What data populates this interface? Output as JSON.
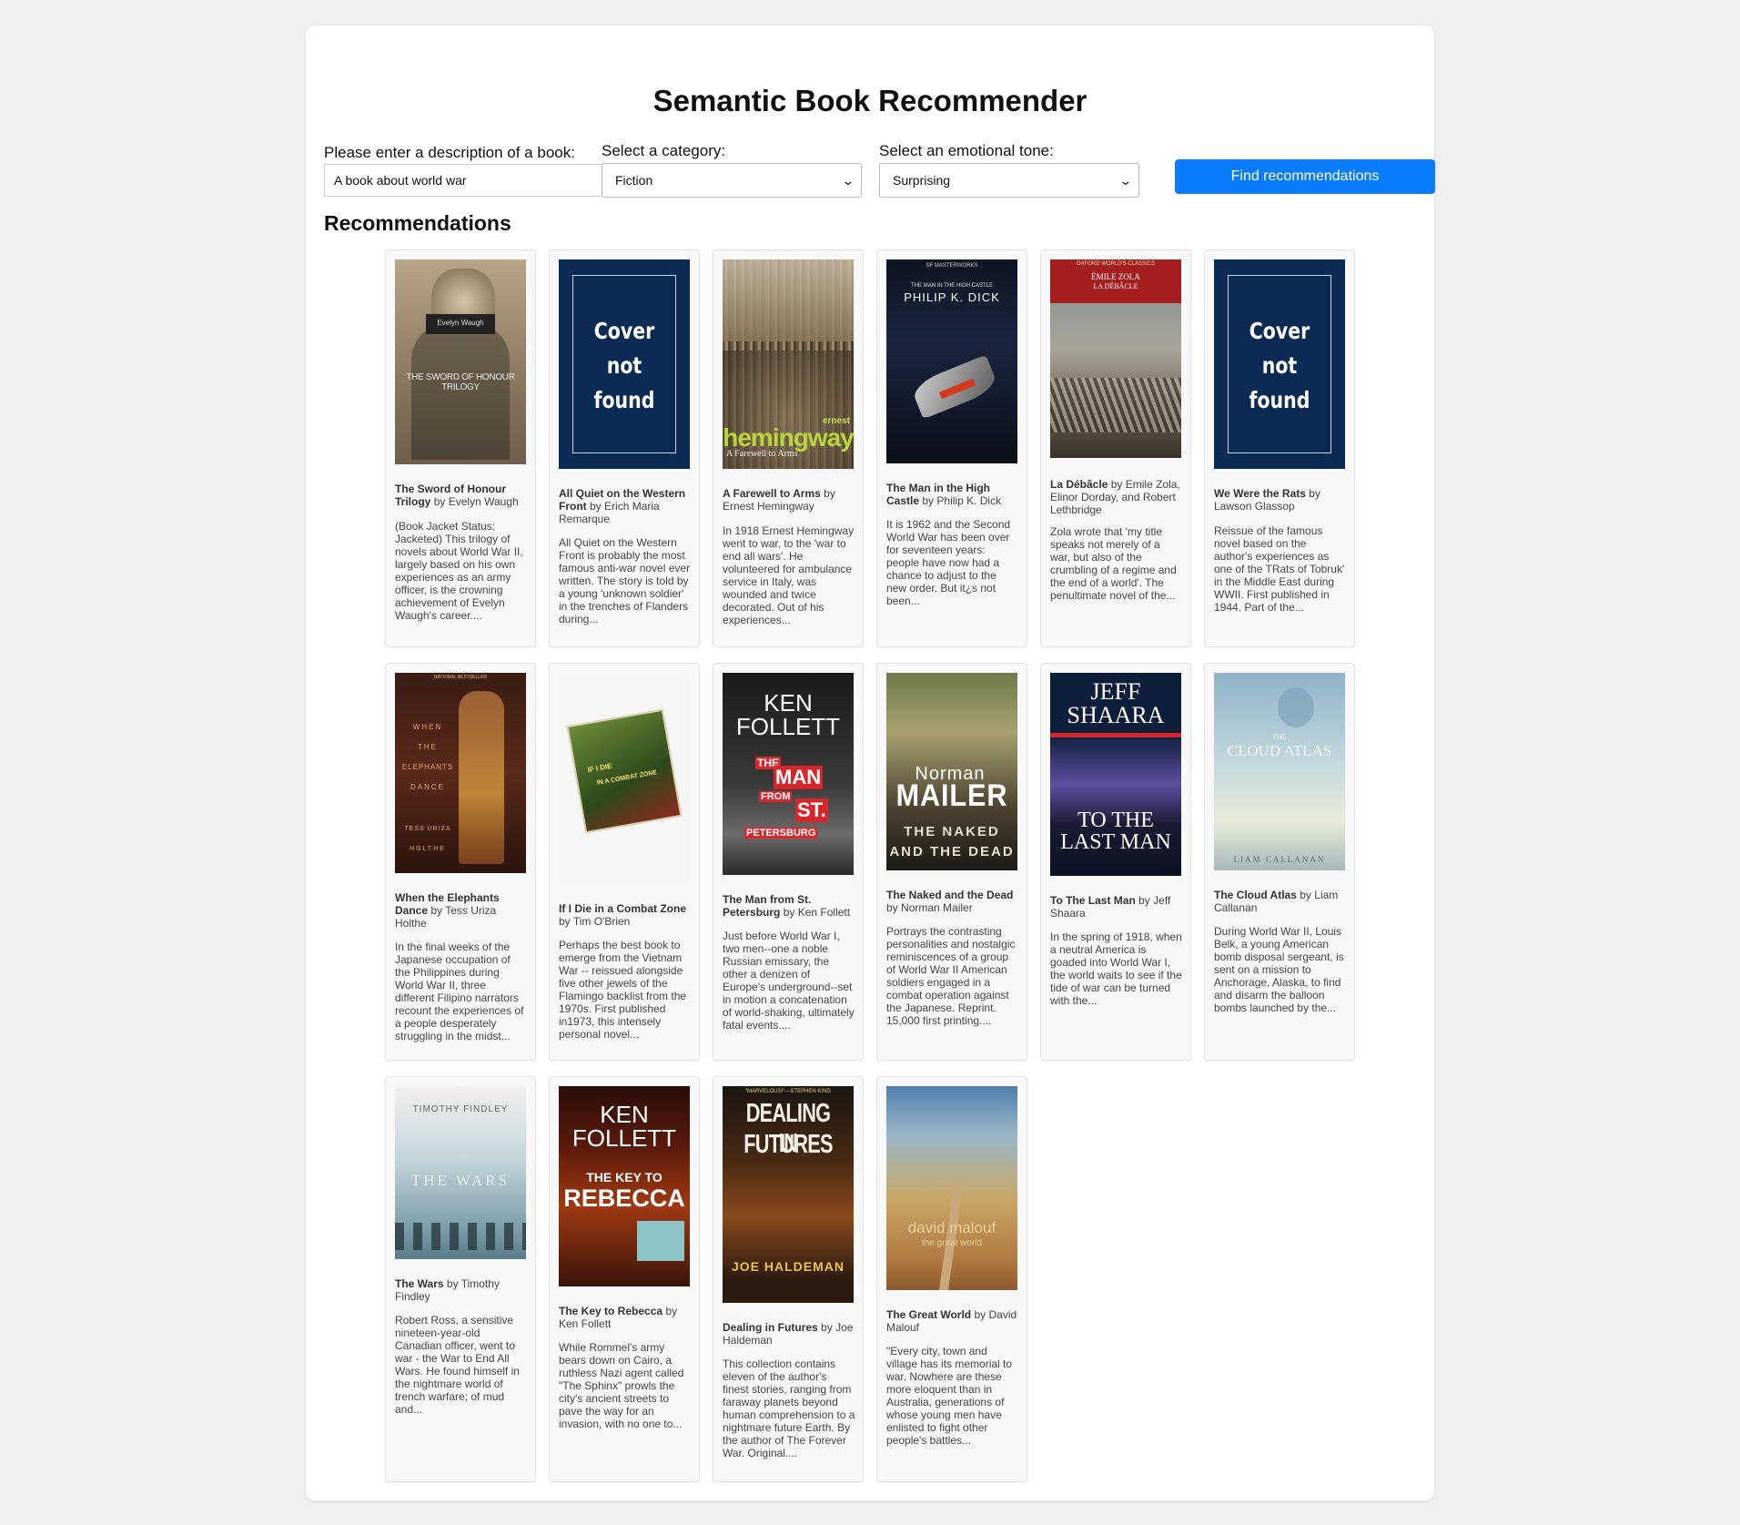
{
  "app": {
    "title": "Semantic Book Recommender"
  },
  "form": {
    "description_label": "Please enter a description of a book:",
    "description_value": "A book about world war",
    "category_label": "Select a category:",
    "category_value": "Fiction",
    "tone_label": "Select an emotional tone:",
    "tone_value": "Surprising",
    "submit_label": "Find recommendations"
  },
  "recommendations_heading": "Recommendations",
  "books": [
    {
      "title": "The Sword of Honour Trilogy",
      "by": "by",
      "author": "Evelyn Waugh",
      "cover": "photo-soldier",
      "cover_text": [
        "Evelyn Waugh",
        "THE SWORD OF HONOUR TRILOGY"
      ],
      "description": "(Book Jacket Status: Jacketed) This trilogy of novels about World War II, largely based on his own experiences as an army officer, is the crowning achievement of Evelyn Waugh's career...."
    },
    {
      "title": "All Quiet on the Western Front",
      "by": "by",
      "author": "Erich Maria Remarque",
      "cover": "not-found",
      "cover_text": [
        "Cover",
        "not",
        "found"
      ],
      "description": "All Quiet on the Western Front is probably the most famous anti-war novel ever written. The story is told by a young 'unknown soldier' in the trenches of Flanders during..."
    },
    {
      "title": "A Farewell to Arms",
      "by": "by",
      "author": "Ernest Hemingway",
      "cover": "city-crowd",
      "cover_text": [
        "ernest",
        "hemingway",
        "A Farewell to Arms"
      ],
      "description": "In 1918 Ernest Hemingway went to war, to the 'war to end all wars'. He volunteered for ambulance service in Italy, was wounded and twice decorated. Out of his experiences..."
    },
    {
      "title": "The Man in the High Castle",
      "by": "by",
      "author": "Philip K. Dick",
      "cover": "space",
      "cover_text": [
        "SF MASTERWORKS",
        "THE MAN IN THE HIGH CASTLE",
        "PHILIP K. DICK"
      ],
      "description": "It is 1962 and the Second World War has been over for seventeen years: people have now had a chance to adjust to the new order. But it¿s not been..."
    },
    {
      "title": "La Débâcle",
      "by": "by",
      "author": "Emile Zola, Elinor Dorday, and Robert Lethbridge",
      "cover": "battle-painting",
      "cover_text": [
        "OXFORD WORLD'S CLASSICS",
        "ÉMILE ZOLA",
        "LA DÉBÂCLE"
      ],
      "description": "Zola wrote that 'my title speaks not merely of a war, but also of the crumbling of a regime and the end of a world'. The penultimate novel of the..."
    },
    {
      "title": "We Were the Rats",
      "by": "by",
      "author": "Lawson Glassop",
      "cover": "not-found",
      "cover_text": [
        "Cover",
        "not",
        "found"
      ],
      "description": "Reissue of the famous novel based on the author's experiences as one of the TRats of Tobruk' in the Middle East during WWII. First published in 1944. Part of the..."
    },
    {
      "title": "When the Elephants Dance",
      "by": "by",
      "author": "Tess Uriza Holthe",
      "cover": "elephants",
      "cover_text": [
        "NATIONAL BESTSELLER",
        "WHEN",
        "THE",
        "ELEPHANTS",
        "DANCE",
        "TESS URIZA",
        "HOLTHE"
      ],
      "description": "In the final weeks of the Japanese occupation of the Philippines during World War II, three different Filipino narrators recount the experiences of a people desperately struggling in the midst..."
    },
    {
      "title": "If I Die in a Combat Zone",
      "by": "by",
      "author": "Tim O'Brien",
      "cover": "combat-zone",
      "cover_text": [
        "IF I DIE",
        "IN A COMBAT ZONE"
      ],
      "description": "Perhaps the best book to emerge from the Vietnam War -- reissued alongside five other jewels of the Flamingo backlist from the 1970s. First published in1973, this intensely personal novel..."
    },
    {
      "title": "The Man from St. Petersburg",
      "by": "by",
      "author": "Ken Follett",
      "cover": "follett-stp",
      "cover_text": [
        "KEN",
        "FOLLETT",
        "THE",
        "MAN",
        "FROM",
        "ST.",
        "PETERSBURG"
      ],
      "description": "Just before World War I, two men--one a noble Russian emissary, the other a denizen of Europe's underground--set in motion a concatenation of world-shaking, ultimately fatal events...."
    },
    {
      "title": "The Naked and the Dead",
      "by": "by",
      "author": "Norman Mailer",
      "cover": "mailer",
      "cover_text": [
        "Norman",
        "MAILER",
        "THE NAKED",
        "AND THE DEAD"
      ],
      "description": "Portrays the contrasting personalities and nostalgic reminiscences of a group of World War II American soldiers engaged in a combat operation against the Japanese. Reprint. 15,000 first printing...."
    },
    {
      "title": "To The Last Man",
      "by": "by",
      "author": "Jeff Shaara",
      "cover": "shaara",
      "cover_text": [
        "JEFF",
        "SHAARA",
        "TO THE",
        "LAST MAN"
      ],
      "description": "In the spring of 1918, when a neutral America is goaded into World War I, the world waits to see if the tide of war can be turned with the..."
    },
    {
      "title": "The Cloud Atlas",
      "by": "by",
      "author": "Liam Callanan",
      "cover": "cloud-atlas",
      "cover_text": [
        "THE",
        "CLOUD ATLAS",
        "LIAM CALLANAN"
      ],
      "description": "During World War II, Louis Belk, a young American bomb disposal sergeant, is sent on a mission to Anchorage, Alaska, to find and disarm the balloon bombs launched by the..."
    },
    {
      "title": "The Wars",
      "by": "by",
      "author": "Timothy Findley",
      "cover": "the-wars",
      "cover_text": [
        "TIMOTHY FINDLEY",
        "THE WARS"
      ],
      "description": "Robert Ross, a sensitive nineteen-year-old Canadian officer, went to war - the War to End All Wars. He found himself in the nightmare world of trench warfare; of mud and..."
    },
    {
      "title": "The Key to Rebecca",
      "by": "by",
      "author": "Ken Follett",
      "cover": "follett-key",
      "cover_text": [
        "KEN",
        "FOLLETT",
        "THE KEY TO",
        "REBECCA"
      ],
      "description": "While Rommel's army bears down on Cairo, a ruthless Nazi agent called \"The Sphinx\" prowls the city's ancient streets to pave the way for an invasion, with no one to..."
    },
    {
      "title": "Dealing in Futures",
      "by": "by",
      "author": "Joe Haldeman",
      "cover": "haldeman",
      "cover_text": [
        "\"MARVELOUS!\"—STEPHEN KING",
        "DEALING IN",
        "FUTURES",
        "JOE HALDEMAN"
      ],
      "description": "This collection contains eleven of the author's finest stories, ranging from faraway planets beyond human comprehension to a nightmare future Earth. By the author of The Forever War. Original...."
    },
    {
      "title": "The Great World",
      "by": "by",
      "author": "David Malouf",
      "cover": "great-world",
      "cover_text": [
        "david malouf",
        "the great world"
      ],
      "description": "\"Every city, town and village has its memorial to war. Nowhere are these more eloquent than in Australia, generations of whose young men have enlisted to fight other people's battles..."
    }
  ],
  "colors": {
    "accent": "#0a7cff",
    "page_bg": "#efefef",
    "card_bg": "#f8f8f8",
    "not_found_cover": "#0b2b55"
  },
  "icons": {
    "select_chevron": "chevron-down-icon"
  }
}
